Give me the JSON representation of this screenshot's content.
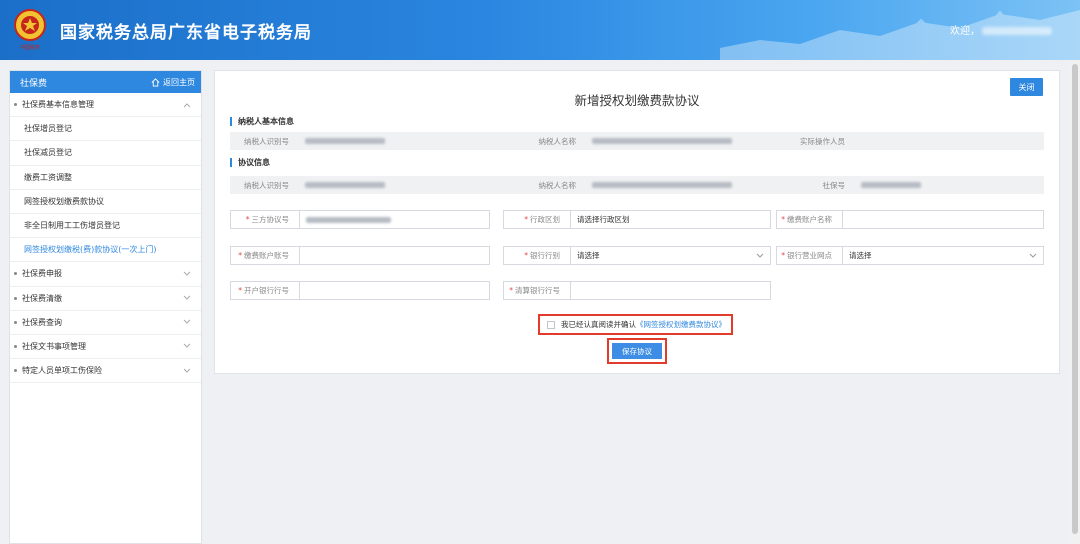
{
  "header": {
    "title": "国家税务总局广东省电子税务局",
    "emblem_caption": "中国税务",
    "welcome": "欢迎，",
    "icons": {
      "emblem": "tax-emblem-icon"
    }
  },
  "sidebar": {
    "title": "社保费",
    "home_link": "返回主页",
    "items": [
      {
        "label": "社保费基本信息管理",
        "type": "group",
        "expanded": true
      },
      {
        "label": "社保增员登记",
        "type": "sub"
      },
      {
        "label": "社保减员登记",
        "type": "sub"
      },
      {
        "label": "缴费工资调整",
        "type": "sub"
      },
      {
        "label": "网签授权划缴费款协议",
        "type": "sub"
      },
      {
        "label": "非全日制用工工伤增员登记",
        "type": "sub"
      },
      {
        "label": "网签授权划缴税(费)款协议(一次上门)",
        "type": "sub",
        "active": true
      },
      {
        "label": "社保费申报",
        "type": "group"
      },
      {
        "label": "社保费清缴",
        "type": "group"
      },
      {
        "label": "社保费查询",
        "type": "group"
      },
      {
        "label": "社保文书事项管理",
        "type": "group"
      },
      {
        "label": "特定人员单项工伤保险",
        "type": "group"
      }
    ]
  },
  "form": {
    "title": "新增授权划缴费款协议",
    "close_label": "关闭",
    "section_basic": "纳税人基本信息",
    "section_agreement": "协议信息",
    "basic": {
      "taxpayer_id_label": "纳税人识别号",
      "taxpayer_name_label": "纳税人名称",
      "operator_label": "实际操作人员"
    },
    "agreement_ro": {
      "taxpayer_id_label": "纳税人识别号",
      "taxpayer_name_label": "纳税人名称",
      "social_no_label": "社保号"
    },
    "fields": {
      "tripartite_no_label": "三方协议号",
      "district_label": "行政区划",
      "district_value": "请选择行政区划",
      "payer_name_label": "缴费账户名称",
      "payer_account_label": "缴费账户账号",
      "bank_label": "银行行别",
      "bank_value": "请选择",
      "branch_label": "银行营业网点",
      "branch_value": "请选择",
      "open_bank_no_label": "开户银行行号",
      "clearing_bank_no_label": "清算银行行号"
    },
    "agree_text": "我已经认真阅读并确认",
    "agree_link": "《网签授权划缴费款协议》",
    "save_label": "保存协议"
  },
  "colors": {
    "accent": "#2f88e0",
    "highlight": "#e33b2b",
    "required": "#e34848"
  }
}
